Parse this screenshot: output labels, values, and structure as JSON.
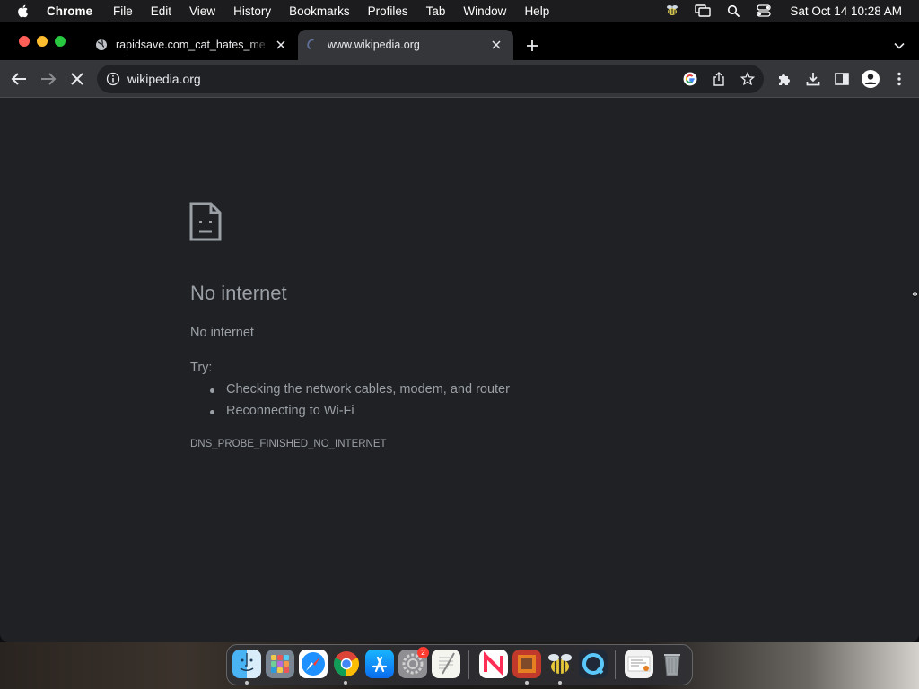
{
  "menubar": {
    "app_name": "Chrome",
    "items": [
      "File",
      "Edit",
      "View",
      "History",
      "Bookmarks",
      "Profiles",
      "Tab",
      "Window",
      "Help"
    ],
    "clock": "Sat Oct 14  10:28 AM"
  },
  "tabs": [
    {
      "title": "rapidsave.com_cat_hates_me",
      "active": false
    },
    {
      "title": "www.wikipedia.org",
      "active": true
    }
  ],
  "omnibox": {
    "url": "wikipedia.org"
  },
  "error_page": {
    "title": "No internet",
    "subtitle": "No internet",
    "try_label": "Try:",
    "suggestions": [
      "Checking the network cables, modem, and router",
      "Reconnecting to Wi-Fi"
    ],
    "error_code": "DNS_PROBE_FINISHED_NO_INTERNET"
  },
  "dock": {
    "apps": [
      "finder",
      "launchpad",
      "safari",
      "chrome",
      "app-store",
      "system-settings",
      "textedit",
      "news",
      "photo-booth",
      "bee-app",
      "quicktime",
      "preview",
      "trash"
    ],
    "settings_badge": "2"
  },
  "colors": {
    "page_bg": "#202124",
    "toolbar_bg": "#35363a",
    "tabstrip_bg": "#000000",
    "error_text": "#9aa0a6"
  }
}
